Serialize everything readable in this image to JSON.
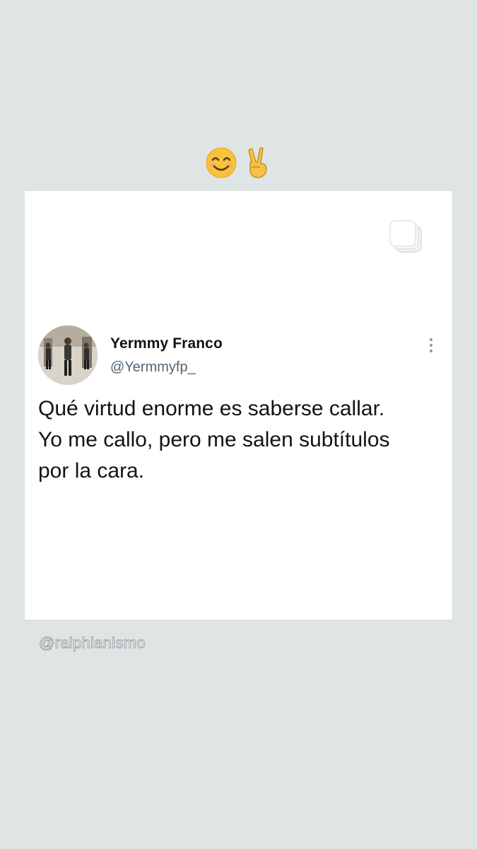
{
  "reactions": {
    "emojis": [
      "smiling-face-icon",
      "victory-hand-icon"
    ],
    "colors": {
      "face": "#f8c23a",
      "hand": "#f6c04a"
    }
  },
  "tweet": {
    "author_name": "Yermmy Franco",
    "author_handle": "@Yermmyfp_",
    "text_lines": [
      "Qué virtud enorme es saberse callar.",
      "Yo me callo, pero me salen subtítulos",
      "por la cara."
    ],
    "icons": [
      "copy-icon",
      "more-options-icon"
    ],
    "colors": {
      "name": "#0f1419",
      "handle": "#536471",
      "card": "#ffffff"
    }
  },
  "watermark": {
    "text": "@ralphianismo"
  },
  "page": {
    "background": "#dfe5e4"
  }
}
